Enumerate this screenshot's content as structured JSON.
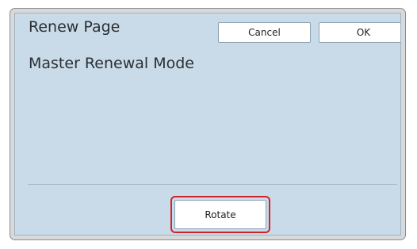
{
  "dialog": {
    "title": "Renew Page",
    "cancel_label": "Cancel",
    "ok_label": "OK",
    "mode_label": "Master Renewal Mode",
    "rotate_label": "Rotate"
  },
  "colors": {
    "panel_background": "#c9dbe8",
    "highlight": "#d0232b"
  }
}
